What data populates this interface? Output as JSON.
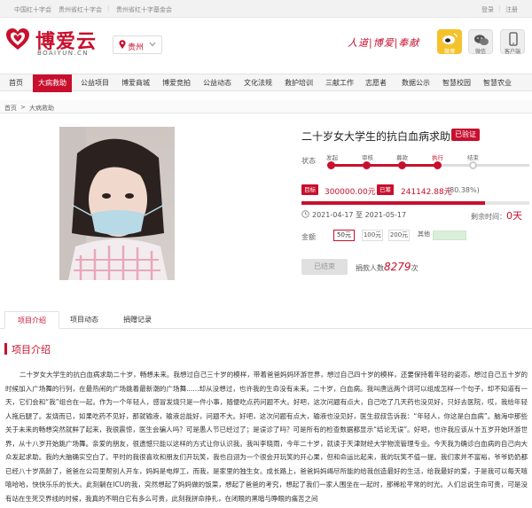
{
  "topbar": {
    "links": [
      "中国红十字会",
      "贵州省红十字会",
      "贵州省红十字基金会"
    ],
    "login": "登录",
    "register": "注册"
  },
  "header": {
    "logo_text": "博爱云",
    "logo_url": "BOAIYUN.CN",
    "region": "贵州",
    "slogan": "人道|博爱|奉献",
    "social": [
      {
        "label": "微博",
        "icon": "weibo-icon"
      },
      {
        "label": "微信",
        "icon": "wechat-icon"
      },
      {
        "label": "客户端",
        "icon": "mobile-app-icon"
      }
    ]
  },
  "nav": {
    "items": [
      "首页",
      "大病救助",
      "公益项目",
      "博爱商城",
      "博爱竞拍",
      "公益动态",
      "文化法规",
      "救护培训",
      "三献工作",
      "志愿者",
      "数据公示",
      "智慧校园",
      "智慧农业"
    ],
    "active_index": 1
  },
  "breadcrumb": {
    "home": "首页",
    "sep": ">",
    "current": "大病救助"
  },
  "project": {
    "title": "二十岁女大学生的抗白血病求助",
    "badge": "已验证",
    "status_label": "状态",
    "stages": [
      "发起",
      "审核",
      "募款",
      "执行",
      "结束"
    ],
    "current_stage_index": 3,
    "target_tag": "目标",
    "target_amount": "300000.00元",
    "raised_tag": "已筹",
    "raised_amount": "241142.88元",
    "raised_pct_text": "(80.38%)",
    "raised_fraction": 0.8038,
    "date_start": "2021-04-17",
    "date_to": "至",
    "date_end": "2021-05-17",
    "remain_label": "剩余时间：",
    "remain_value": "0天",
    "amount_label": "金额",
    "amount_options": [
      "50元",
      "100元",
      "200元",
      "其他"
    ],
    "selected_amount_index": 0,
    "ended_button": "已结束",
    "donors_prefix": "捐款人数",
    "donors_count": "8279",
    "donors_suffix": "次"
  },
  "tabs": {
    "items": [
      "项目介绍",
      "项目动态",
      "捐赠记录"
    ],
    "active_index": 0
  },
  "section": {
    "title": "项目介绍",
    "body": "二十岁女大学生的抗白血病求助二十岁，畅想未来。我想过自己三十岁的模样，带着爸爸妈妈环游世界，想过自己四十岁的模样，还要保持着年轻的姿态，想过自己五十岁的时候加入广场舞的行列，在最热闹的广场跳着最新潮的广场舞......却从没想过，也许我的生命没有未来。二十岁，白血病。我叫唐远两个词可以组成怎样一个句子，却不知道有一天，它们会和“我”组合在一起。作为一个年轻人，感冒发烧只是一件小事，随便吃点药问题不大。好吧，这次问题有点大，自己吃了几天药也没见好，只好去医院，哎，我给年轻人拖后腿了。发烧而已，如果吃药不见好，那就输液，输液总能好，问题不大。好吧，这次问题有点大，输液也没见好，医生叔叔告诉我：“年轻人，你这是白血病”。脑海中那些关于未来的畅想突然就鲜了起来，我很震惊，医生会骗人吗？可是愚人节已经过了；是误诊了吗？可是所有的检查数据都显示“结论无误”。好吧，也许我应该从十五岁开始环游世界，从十八岁开始跳广场舞。亲爱的朋友，很遗憾只能以这样的方式让你认识我。我叫李晓雨，今年二十岁，就读于天津财经大学物流管理专业。今天我为确诊白血病的自己向大众发起求助。我的大脑确实空白了。平时的我很喜欢和朋友们开玩笑，我也自诩为一个很会开玩笑的开心果，但和命运比起来，我的玩笑不值一提。我们家并不富裕，爷爷奶奶都已经八十岁高龄了，爸爸在公司里帮别人开车，妈妈是电焊工，而我，是家里的独生女。成长路上，爸爸妈妈竭尽所能的给我创造最好的生活，给我最好的爱，于是我可以每天嘻嘻哈哈，快快乐乐的长大。此刻躺在ICU的我，突然想起了妈妈做的饭菜，想起了爸爸的考究，想起了我们一家人围坐在一起时，那稀松平常的时光。人们总说生命可贵，可是没有站在生死交界线的时候，我真的不明白它有多么可贵，此刻我拼命挣扎，在闭眼的黑暗与睁眼的痛苦之间"
  },
  "colors": {
    "brand": "#c8102e",
    "nav_bg": "#f5f5f5",
    "other_input_bg": "#d9efd9"
  }
}
